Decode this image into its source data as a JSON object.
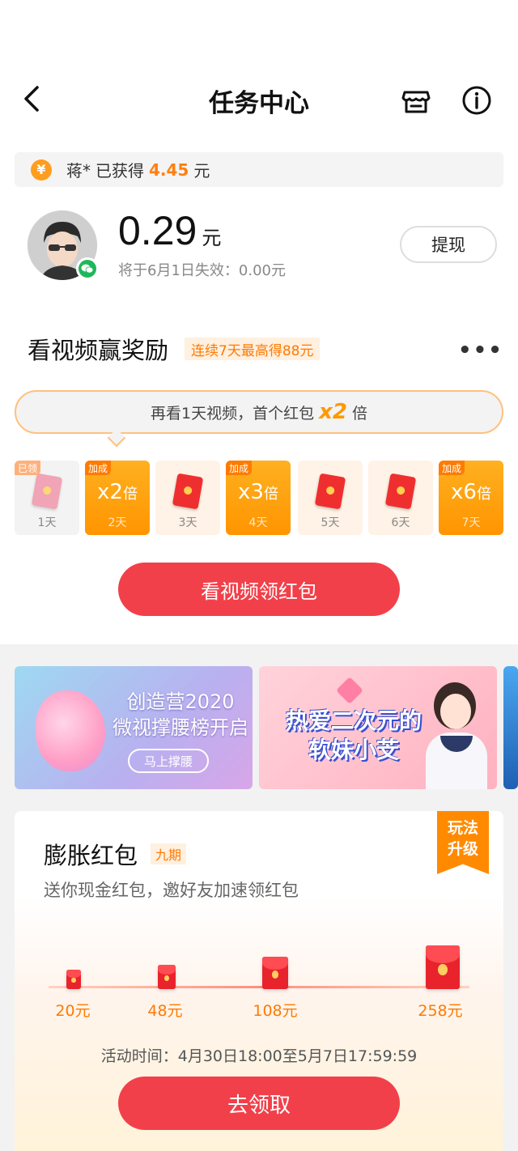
{
  "header": {
    "title": "任务中心",
    "back_icon": "chevron-left-icon",
    "shop_icon": "store-icon",
    "info_icon": "info-icon"
  },
  "earn_banner": {
    "coin_symbol": "¥",
    "user": "蒋*",
    "text": "已获得",
    "amount": "4.45",
    "unit": "元"
  },
  "wallet": {
    "balance": "0.29",
    "unit": "元",
    "expire_text": "将于6月1日失效：0.00元",
    "withdraw_label": "提现"
  },
  "video_reward": {
    "title": "看视频赢奖励",
    "tag": "连续7天最高得88元",
    "more": "•••",
    "bubble_prefix": "再看1天视频，首个红包",
    "bubble_mult": "x2",
    "bubble_suffix": "倍",
    "days": [
      {
        "label": "1天",
        "tag": "已领",
        "mult": ""
      },
      {
        "label": "2天",
        "tag": "加成",
        "mult": "x2",
        "mult_unit": "倍"
      },
      {
        "label": "3天",
        "tag": "",
        "mult": ""
      },
      {
        "label": "4天",
        "tag": "加成",
        "mult": "x3",
        "mult_unit": "倍"
      },
      {
        "label": "5天",
        "tag": "",
        "mult": ""
      },
      {
        "label": "6天",
        "tag": "",
        "mult": ""
      },
      {
        "label": "7天",
        "tag": "加成",
        "mult": "x6",
        "mult_unit": "倍"
      }
    ],
    "button_label": "看视频领红包"
  },
  "banners": [
    {
      "title_line1": "创造营2020",
      "title_line2": "微视撑腰榜开启",
      "button": "马上撑腰"
    },
    {
      "title_line1": "热爱二次元的",
      "title_line2": "软妹小芠"
    }
  ],
  "red_packet": {
    "title": "膨胀红包",
    "tag": "九期",
    "subtitle": "送你现金红包，邀好友加速领红包",
    "ribbon_line1": "玩法",
    "ribbon_line2": "升级",
    "tiers": [
      "20元",
      "48元",
      "108元",
      "258元"
    ],
    "activity_time": "活动时间：4月30日18:00至5月7日17:59:59",
    "button_label": "去领取"
  },
  "colors": {
    "accent_red": "#f2404a",
    "accent_orange": "#ff9500",
    "wechat_green": "#1fb75b"
  }
}
